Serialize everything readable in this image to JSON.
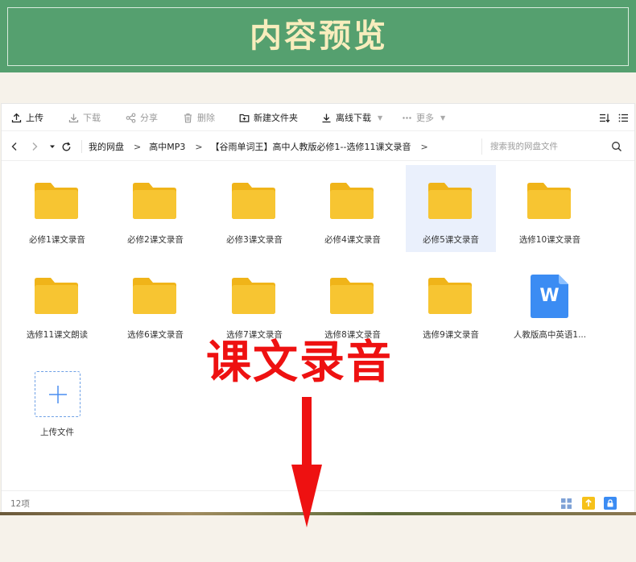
{
  "banner": {
    "title": "内容预览"
  },
  "toolbar": {
    "upload": "上传",
    "download": "下载",
    "share": "分享",
    "delete": "删除",
    "new_folder": "新建文件夹",
    "offline_download": "离线下载",
    "more": "更多"
  },
  "breadcrumb": [
    "我的网盘",
    "高中MP3",
    "【谷雨单词王】高中人教版必修1--选修11课文录音"
  ],
  "breadcrumb_sep": ">",
  "search": {
    "placeholder": "搜索我的网盘文件"
  },
  "files": [
    {
      "name": "必修1课文录音",
      "type": "folder"
    },
    {
      "name": "必修2课文录音",
      "type": "folder"
    },
    {
      "name": "必修3课文录音",
      "type": "folder"
    },
    {
      "name": "必修4课文录音",
      "type": "folder"
    },
    {
      "name": "必修5课文录音",
      "type": "folder",
      "selected": true
    },
    {
      "name": "选修10课文录音",
      "type": "folder"
    },
    {
      "name": "选修11课文朗读",
      "type": "folder"
    },
    {
      "name": "选修6课文录音",
      "type": "folder"
    },
    {
      "name": "选修7课文录音",
      "type": "folder"
    },
    {
      "name": "选修8课文录音",
      "type": "folder"
    },
    {
      "name": "选修9课文录音",
      "type": "folder"
    },
    {
      "name": "人教版高中英语1...",
      "type": "word-doc",
      "icon_letter": "W"
    }
  ],
  "upload_tile": {
    "label": "上传文件"
  },
  "status": {
    "count": "12项"
  },
  "overlay": {
    "text": "课文录音"
  },
  "colors": {
    "banner_bg": "#55a06f",
    "banner_title": "#f8edbd",
    "folder": "#f7c532",
    "folder_tab": "#f0b419",
    "word_doc": "#3b8cf3",
    "selection": "#eaf0fc",
    "overlay_red": "#ee1111"
  },
  "icons": {
    "toolbar": [
      "upload-icon",
      "download-icon",
      "share-icon",
      "delete-icon",
      "new-folder-icon",
      "offline-download-icon",
      "more-icon",
      "sort-icon",
      "list-view-icon"
    ],
    "nav": [
      "back-icon",
      "forward-icon",
      "history-dropdown-icon",
      "refresh-icon",
      "search-icon"
    ],
    "status": [
      "grid-view-icon",
      "upload-queue-icon",
      "lock-icon"
    ]
  }
}
